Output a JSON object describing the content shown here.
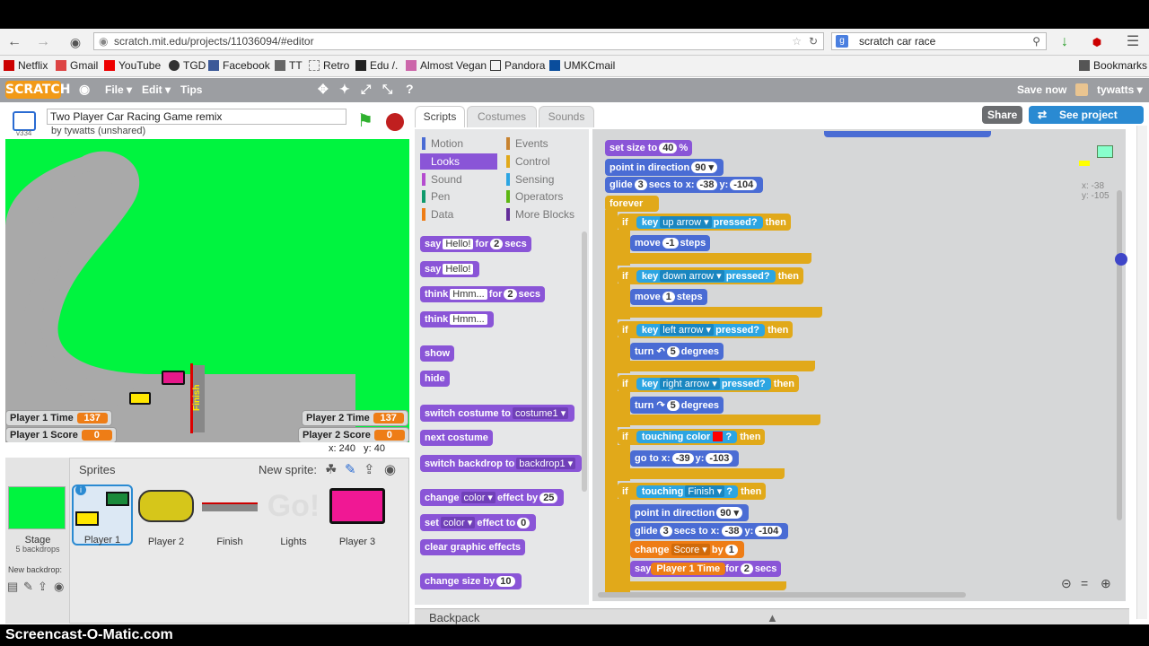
{
  "browser": {
    "url": "scratch.mit.edu/projects/11036094/#editor",
    "search": "scratch car race",
    "bookmarks": [
      "Netflix",
      "Gmail",
      "YouTube",
      "TGD",
      "Facebook",
      "TT",
      "Retro",
      "Edu /.",
      "Almost Vegan",
      "Pandora",
      "UMKCmail"
    ],
    "bookmarks_folder": "Bookmarks"
  },
  "scratch_menu": {
    "logo": "SCRATCH",
    "file": "File ▾",
    "edit": "Edit ▾",
    "tips": "Tips",
    "save": "Save now",
    "user": "tywatts ▾"
  },
  "project": {
    "title": "Two Player Car Racing Game remix",
    "author": "by tywatts (unshared)",
    "version": "v334"
  },
  "stage": {
    "finish_label": "Finish",
    "coords_x": "x: 240",
    "coords_y": "y: 40"
  },
  "monitors": {
    "p1_time_label": "Player 1 Time",
    "p1_time": "137",
    "p1_score_label": "Player 1 Score",
    "p1_score": "0",
    "p2_time_label": "Player 2 Time",
    "p2_time": "137",
    "p2_score_label": "Player 2 Score",
    "p2_score": "0"
  },
  "sprites_panel": {
    "title": "Sprites",
    "new_sprite": "New sprite:",
    "stage_label": "Stage",
    "stage_sub": "5 backdrops",
    "new_backdrop": "New backdrop:",
    "items": [
      "Player 1",
      "Player 2",
      "Finish",
      "Lights",
      "Player 3"
    ]
  },
  "tabs": {
    "scripts": "Scripts",
    "costumes": "Costumes",
    "sounds": "Sounds"
  },
  "share": "Share",
  "see_project": "See project page",
  "categories": {
    "motion": "Motion",
    "looks": "Looks",
    "sound": "Sound",
    "pen": "Pen",
    "data": "Data",
    "events": "Events",
    "control": "Control",
    "sensing": "Sensing",
    "operators": "Operators",
    "more": "More Blocks"
  },
  "palette": {
    "say_for": "say",
    "say_for_val": "Hello!",
    "say_for_mid": "for",
    "say_for_secs": "2",
    "say_for_end": "secs",
    "say": "say",
    "say_val": "Hello!",
    "think_for": "think",
    "think_for_val": "Hmm...",
    "think_for_mid": "for",
    "think_for_secs": "2",
    "think_for_end": "secs",
    "think": "think",
    "think_val": "Hmm...",
    "show": "show",
    "hide": "hide",
    "switch_costume": "switch costume to",
    "switch_costume_val": "costume1 ▾",
    "next_costume": "next costume",
    "switch_backdrop": "switch backdrop to",
    "switch_backdrop_val": "backdrop1 ▾",
    "change_effect": "change",
    "change_effect_val": "color ▾",
    "change_effect_mid": "effect by",
    "change_effect_num": "25",
    "set_effect": "set",
    "set_effect_val": "color ▾",
    "set_effect_mid": "effect to",
    "set_effect_num": "0",
    "clear_effects": "clear graphic effects",
    "change_size": "change size by",
    "change_size_num": "10"
  },
  "script": {
    "set_size": "set size to",
    "set_size_val": "40",
    "set_size_unit": "%",
    "point_dir": "point in direction",
    "point_dir_val": "90 ▾",
    "glide": "glide",
    "glide_secs": "3",
    "glide_mid": "secs to x:",
    "glide_x": "-38",
    "glide_y_lbl": "y:",
    "glide_y": "-104",
    "forever": "forever",
    "if": "if",
    "then": "then",
    "key": "key",
    "pressed": "pressed?",
    "up_arrow": "up arrow ▾",
    "down_arrow": "down arrow ▾",
    "left_arrow": "left arrow ▾",
    "right_arrow": "right arrow ▾",
    "move": "move",
    "steps": "steps",
    "move_up": "-1",
    "move_down": "1",
    "turn": "turn",
    "degrees": "degrees",
    "turn_left_sym": "↶",
    "turn_right_sym": "↷",
    "turn_val": "5",
    "touching_color": "touching color",
    "q": "?",
    "goto": "go to x:",
    "goto_x": "-39",
    "goto_y_lbl": "y:",
    "goto_y": "-103",
    "touching": "touching",
    "touching_val": "Finish ▾",
    "point_dir2_val": "90 ▾",
    "glide2_secs": "3",
    "glide2_x": "-38",
    "glide2_y": "-104",
    "change": "change",
    "change_var": "Score ▾",
    "change_by": "by",
    "change_val": "1",
    "say": "say",
    "say_var": "Player 1 Time",
    "say_for": "for",
    "say_secs": "2",
    "say_end": "secs",
    "sprite_x": "x: -38",
    "sprite_y": "y: -105"
  },
  "backpack": "Backpack",
  "watermark": "Screencast-O-Matic.com",
  "colors": {
    "motion": "#4a6cd4",
    "looks": "#8a55d7",
    "control": "#e1a91a",
    "sensing": "#2ca5e2",
    "data": "#ee7d16",
    "stage_bg": "#00f43f"
  }
}
